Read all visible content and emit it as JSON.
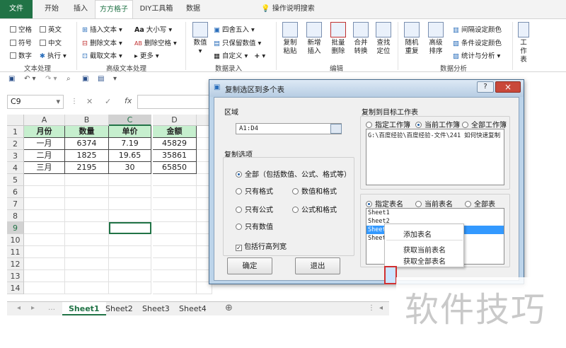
{
  "tabs": [
    "文件",
    "开始",
    "插入",
    "方方格子",
    "DIY工具箱",
    "数据",
    "操作说明搜索"
  ],
  "ribbon": {
    "text_group": {
      "checks": [
        "空格",
        "英文",
        "符号",
        "中文",
        "数字"
      ],
      "exec": "执行",
      "name": "文本处理"
    },
    "adv_group": {
      "items": [
        "插入文本",
        "删除文本",
        "截取文本",
        "大小写",
        "删除空格",
        "更多"
      ],
      "name": "高级文本处理"
    },
    "num_group": {
      "items": [
        "数值",
        "四舍五入",
        "只保留数值",
        "自定义"
      ],
      "name": "数据录入"
    },
    "edit_group": {
      "buttons": [
        "复制粘贴",
        "新增插入",
        "批量删除",
        "合并转换",
        "查找定位"
      ],
      "name": "编辑"
    },
    "analysis_group": {
      "buttons": [
        "随机重复",
        "高级排序"
      ],
      "items": [
        "间隔设定颜色",
        "条件设定颜色",
        "统计与分析"
      ],
      "name": "数据分析"
    },
    "right_item": "工作表"
  },
  "formula_bar": {
    "name_box": "C9",
    "fx": "fx"
  },
  "grid": {
    "columns": [
      "A",
      "B",
      "C",
      "D"
    ],
    "rows": [
      "1",
      "2",
      "3",
      "4",
      "5",
      "6",
      "7",
      "8",
      "9",
      "10",
      "11",
      "12",
      "13",
      "14"
    ],
    "header": [
      "月份",
      "数量",
      "单价",
      "金额"
    ],
    "data": [
      [
        "一月",
        "6374",
        "7.19",
        "45829"
      ],
      [
        "二月",
        "1825",
        "19.65",
        "35861"
      ],
      [
        "三月",
        "2195",
        "30",
        "65850"
      ]
    ]
  },
  "sheet_tabs": [
    "Sheet1",
    "Sheet2",
    "Sheet3",
    "Sheet4"
  ],
  "dialog": {
    "title": "复制选区到多个表",
    "help": "?",
    "close": "×",
    "range_label": "区域",
    "range_value": "A1:D4",
    "copy_options_label": "复制选项",
    "options": [
      "全部（包括数值、公式、格式等）",
      "只有格式",
      "数值和格式",
      "只有公式",
      "公式和格式",
      "只有数值"
    ],
    "include_row_height": "包括行高列宽",
    "ok": "确定",
    "exit": "退出",
    "target_label": "复制到目标工作表",
    "wb_options": [
      "指定工作簿",
      "当前工作簿",
      "全部工作簿"
    ],
    "wb_path": "G:\\百度经验\\百度经验-文件\\241 如何快速复制",
    "sheet_options": [
      "指定表名",
      "当前表名",
      "全部表"
    ],
    "sheet_list": [
      "Sheet1",
      "Sheet2",
      "Sheet3",
      "Sheet4"
    ]
  },
  "context_menu": [
    "添加表名",
    "获取当前表名",
    "获取全部表名"
  ],
  "watermark": "软件技巧"
}
